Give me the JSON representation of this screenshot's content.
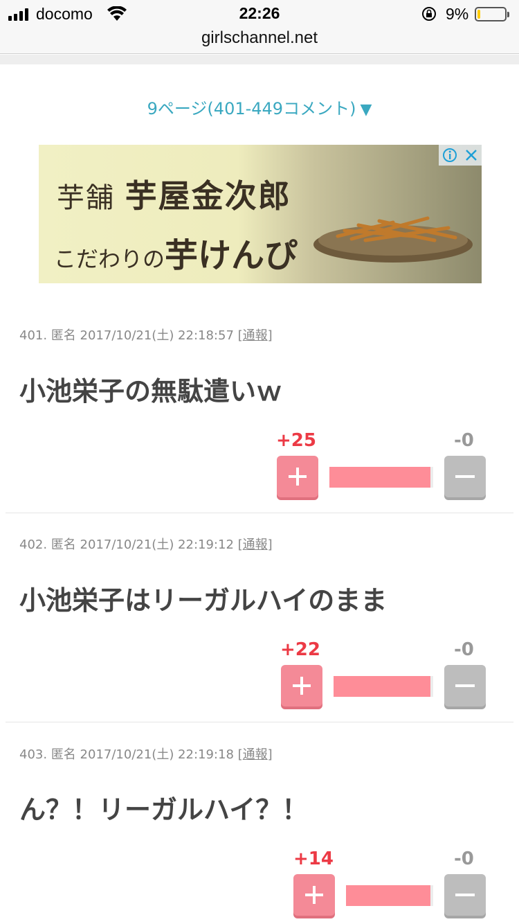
{
  "status_bar": {
    "carrier": "docomo",
    "time": "22:26",
    "battery_percent": "9%",
    "battery_level": 0.09
  },
  "browser": {
    "url": "girlschannel.net"
  },
  "pager": {
    "label": "9ページ(401-449コメント)",
    "arrow": "▼"
  },
  "ad": {
    "line1_small": "芋舗",
    "line1_brand": "芋屋金次郎",
    "line2_small": "こだわりの",
    "line2_big": "芋けんぴ",
    "info_icon": "info-icon",
    "close_icon": "close-icon"
  },
  "comments": [
    {
      "number": "401.",
      "author": "匿名",
      "datetime": "2017/10/21(土) 22:18:57",
      "report": "通報",
      "body": "小池栄子の無駄遣いｗ",
      "plus": "+25",
      "minus": "-0",
      "plus_ratio": 1.0
    },
    {
      "number": "402.",
      "author": "匿名",
      "datetime": "2017/10/21(土) 22:19:12",
      "report": "通報",
      "body": "小池栄子はリーガルハイのまま",
      "plus": "+22",
      "minus": "-0",
      "plus_ratio": 1.0
    },
    {
      "number": "403.",
      "author": "匿名",
      "datetime": "2017/10/21(土) 22:19:18",
      "report": "通報",
      "body": "ん？！リーガルハイ？！",
      "plus": "+14",
      "minus": "-0",
      "plus_ratio": 1.0
    }
  ],
  "colors": {
    "plus": "#ec3a45",
    "plus_button": "#f48a97",
    "minus_button": "#bdbdbd",
    "link": "#3aa8c0"
  }
}
